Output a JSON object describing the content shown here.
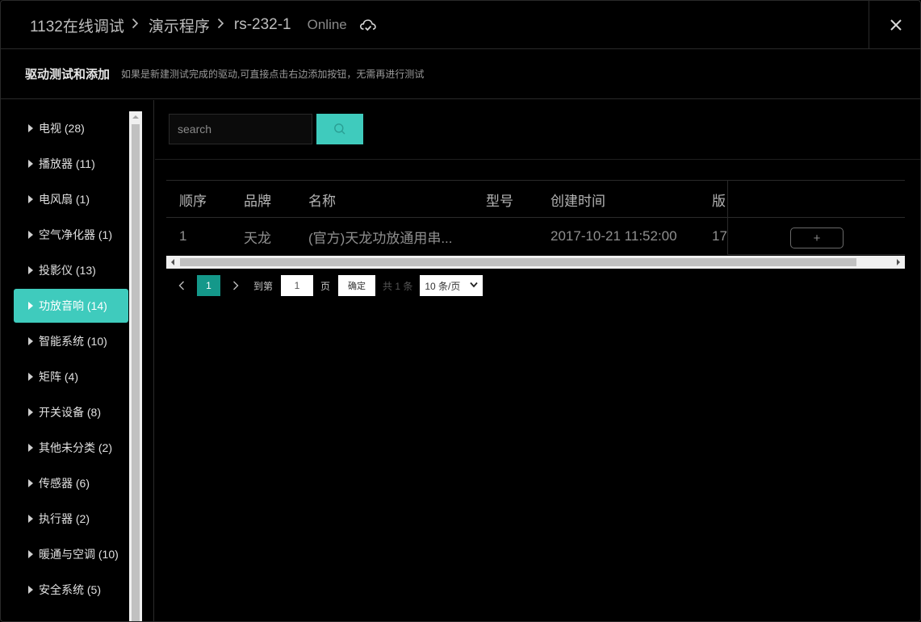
{
  "header": {
    "breadcrumb": [
      "1132在线调试",
      "演示程序",
      "rs-232-1"
    ],
    "status": "Online",
    "cloud_icon": "cloud-check-icon",
    "close_icon": "close-icon"
  },
  "section": {
    "title": "驱动测试和添加",
    "hint": "如果是新建测试完成的驱动,可直接点击右边添加按钮，无需再进行测试"
  },
  "sidebar": {
    "items": [
      {
        "label": "电视 (28)"
      },
      {
        "label": "播放器 (11)"
      },
      {
        "label": "电风扇 (1)"
      },
      {
        "label": "空气净化器 (1)"
      },
      {
        "label": "投影仪 (13)"
      },
      {
        "label": "功放音响 (14)",
        "active": true
      },
      {
        "label": "智能系统 (10)"
      },
      {
        "label": "矩阵 (4)"
      },
      {
        "label": "开关设备 (8)"
      },
      {
        "label": "其他未分类 (2)"
      },
      {
        "label": "传感器 (6)"
      },
      {
        "label": "执行器 (2)"
      },
      {
        "label": "暖通与空调 (10)"
      },
      {
        "label": "安全系统 (5)"
      }
    ]
  },
  "search": {
    "placeholder": "search",
    "icon": "search-icon"
  },
  "table": {
    "columns": [
      "顺序",
      "品牌",
      "名称",
      "型号",
      "创建时间",
      "版"
    ],
    "rows": [
      {
        "idx": "1",
        "brand": "天龙",
        "name": "(官方)天龙功放通用串...",
        "model": "",
        "time": "2017-10-21 11:52:00",
        "ver": "17",
        "action": "+"
      }
    ]
  },
  "pagination": {
    "current": "1",
    "goto_label": "到第",
    "page_input": "1",
    "page_unit": "页",
    "confirm": "确定",
    "total": "共 1 条",
    "page_size": "10 条/页"
  },
  "colors": {
    "accent": "#3fcbbd",
    "page_active": "#14988a",
    "background": "#000000"
  }
}
